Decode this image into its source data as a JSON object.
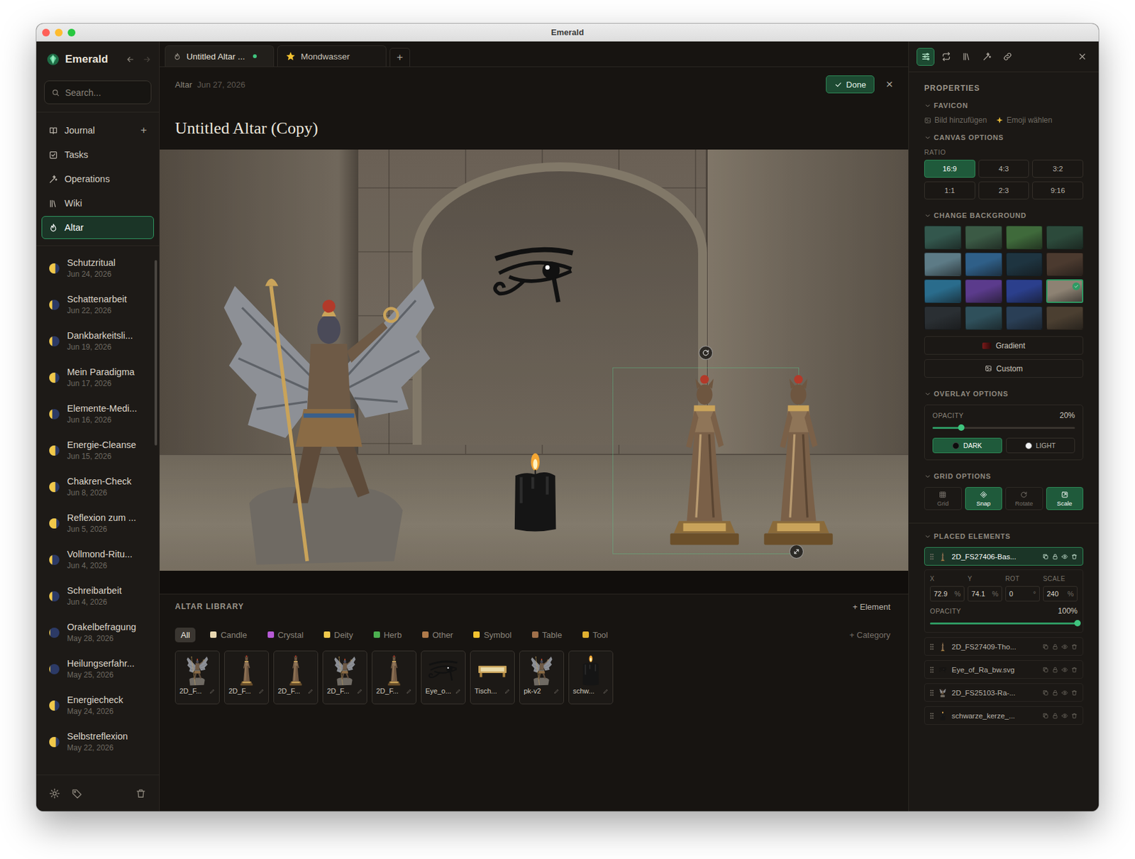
{
  "window": {
    "title": "Emerald"
  },
  "sidebar": {
    "brand": "Emerald",
    "search": {
      "placeholder": "Search..."
    },
    "nav": [
      {
        "label": "Journal",
        "kind": "journal",
        "add": "+",
        "selected": false
      },
      {
        "label": "Tasks",
        "kind": "tasks",
        "selected": false
      },
      {
        "label": "Operations",
        "kind": "operations",
        "selected": false
      },
      {
        "label": "Wiki",
        "kind": "wiki",
        "selected": false
      },
      {
        "label": "Altar",
        "kind": "altar",
        "selected": true
      }
    ],
    "entries": [
      {
        "title": "Schutzritual",
        "date": "Jun 24, 2026",
        "moon": 0.6
      },
      {
        "title": "Schattenarbeit",
        "date": "Jun 22, 2026",
        "moon": 0.3
      },
      {
        "title": "Dankbarkeitsli...",
        "date": "Jun 19, 2026",
        "moon": 0.3
      },
      {
        "title": "Mein Paradigma",
        "date": "Jun 17, 2026",
        "moon": 0.6
      },
      {
        "title": "Elemente-Medi...",
        "date": "Jun 16, 2026",
        "moon": 0.3
      },
      {
        "title": "Energie-Cleanse",
        "date": "Jun 15, 2026",
        "moon": 0.6
      },
      {
        "title": "Chakren-Check",
        "date": "Jun 8, 2026",
        "moon": 0.6
      },
      {
        "title": "Reflexion zum ...",
        "date": "Jun 5, 2026",
        "moon": 0.7
      },
      {
        "title": "Vollmond-Ritu...",
        "date": "Jun 4, 2026",
        "moon": 0.3
      },
      {
        "title": "Schreibarbeit",
        "date": "Jun 4, 2026",
        "moon": 0.3
      },
      {
        "title": "Orakelbefragung",
        "date": "May 28, 2026",
        "moon": 0.1
      },
      {
        "title": "Heilungserfahr...",
        "date": "May 25, 2026",
        "moon": 0.1
      },
      {
        "title": "Energiecheck",
        "date": "May 24, 2026",
        "moon": 0.55
      },
      {
        "title": "Selbstreflexion",
        "date": "May 22, 2026",
        "moon": 0.65
      }
    ]
  },
  "tabs": [
    {
      "label": "Untitled Altar ...",
      "kind": "altar",
      "unsaved": true,
      "selected": true
    },
    {
      "label": "Mondwasser",
      "kind": "star",
      "unsaved": false,
      "selected": false
    }
  ],
  "new_tab": "+",
  "header": {
    "breadcrumb": "Altar",
    "date": "Jun 27, 2026",
    "done": "Done",
    "close": "×"
  },
  "title": "Untitled Altar (Copy)",
  "library": {
    "title": "ALTAR LIBRARY",
    "add_element": "+ Element",
    "add_category": "+ Category",
    "categories": [
      {
        "label": "All",
        "selected": true
      },
      {
        "label": "Candle",
        "selected": false,
        "color": "#e8d7b0"
      },
      {
        "label": "Crystal",
        "selected": false,
        "color": "#b65ad6"
      },
      {
        "label": "Deity",
        "selected": false,
        "color": "#f2c94c"
      },
      {
        "label": "Herb",
        "selected": false,
        "color": "#4caf50"
      },
      {
        "label": "Other",
        "selected": false,
        "color": "#b07a4a"
      },
      {
        "label": "Symbol",
        "selected": false,
        "color": "#f2c230"
      },
      {
        "label": "Table",
        "selected": false,
        "color": "#a0704a"
      },
      {
        "label": "Tool",
        "selected": false,
        "color": "#e0b030"
      }
    ],
    "items": [
      {
        "label": "2D_F...",
        "kind": "winged"
      },
      {
        "label": "2D_F...",
        "kind": "statue"
      },
      {
        "label": "2D_F...",
        "kind": "statue"
      },
      {
        "label": "2D_F...",
        "kind": "winged"
      },
      {
        "label": "2D_F...",
        "kind": "statue"
      },
      {
        "label": "Eye_o...",
        "kind": "eye"
      },
      {
        "label": "Tisch...",
        "kind": "table"
      },
      {
        "label": "pk-v2",
        "kind": "winged"
      },
      {
        "label": "schw...",
        "kind": "candle"
      }
    ]
  },
  "properties": {
    "title": "PROPERTIES",
    "favicon": {
      "title": "FAVICON",
      "add_image": "Bild hinzufügen",
      "choose_emoji": "Emoji wählen"
    },
    "canvas": {
      "title": "CANVAS OPTIONS",
      "ratio_label": "RATIO",
      "ratios": [
        {
          "label": "16:9",
          "selected": true
        },
        {
          "label": "4:3",
          "selected": false
        },
        {
          "label": "3:2",
          "selected": false
        },
        {
          "label": "1:1",
          "selected": false
        },
        {
          "label": "2:3",
          "selected": false
        },
        {
          "label": "9:16",
          "selected": false
        }
      ]
    },
    "background": {
      "title": "CHANGE BACKGROUND",
      "swatches": [
        {
          "color": "#33574d",
          "selected": false
        },
        {
          "color": "#3b5a45",
          "selected": false
        },
        {
          "color": "#3f6a3b",
          "selected": false
        },
        {
          "color": "#2c4a3b",
          "selected": false
        },
        {
          "color": "#5d7b86",
          "selected": false
        },
        {
          "color": "#2f5f88",
          "selected": false
        },
        {
          "color": "#1e3440",
          "selected": false
        },
        {
          "color": "#4b3a2f",
          "selected": false
        },
        {
          "color": "#2a6c8c",
          "selected": false
        },
        {
          "color": "#5b3b8c",
          "selected": false
        },
        {
          "color": "#2b3f8c",
          "selected": false
        },
        {
          "color": "#8d8273",
          "selected": true
        },
        {
          "color": "#2a2f33",
          "selected": false
        },
        {
          "color": "#2f505b",
          "selected": false
        },
        {
          "color": "#2a3f56",
          "selected": false
        },
        {
          "color": "#4b3f31",
          "selected": false
        }
      ],
      "gradient": "Gradient",
      "custom": "Custom"
    },
    "overlay": {
      "title": "OVERLAY OPTIONS",
      "opacity_label": "OPACITY",
      "opacity": "20%",
      "level": 0.2,
      "modes": [
        {
          "label": "DARK",
          "kind": "dark",
          "selected": true
        },
        {
          "label": "LIGHT",
          "kind": "light",
          "selected": false
        }
      ]
    },
    "grid": {
      "title": "GRID OPTIONS",
      "options": [
        {
          "label": "Grid",
          "kind": "grid",
          "on": false
        },
        {
          "label": "Snap",
          "kind": "snap",
          "on": true
        },
        {
          "label": "Rotate",
          "kind": "rotate",
          "on": false
        },
        {
          "label": "Scale",
          "kind": "scale",
          "on": true
        }
      ]
    },
    "placed": {
      "title": "PLACED ELEMENTS",
      "elements": [
        {
          "name": "2D_FS27406-Bas...",
          "kind": "statue",
          "selected": true
        },
        {
          "name": "2D_FS27409-Tho...",
          "kind": "statue",
          "selected": false
        },
        {
          "name": "Eye_of_Ra_bw.svg",
          "kind": "eye",
          "selected": false
        },
        {
          "name": "2D_FS25103-Ra-...",
          "kind": "winged",
          "selected": false
        },
        {
          "name": "schwarze_kerze_...",
          "kind": "candle",
          "selected": false
        }
      ],
      "detail": {
        "fields": [
          {
            "label": "X",
            "value": "72.9",
            "unit": "%"
          },
          {
            "label": "Y",
            "value": "74.1",
            "unit": "%"
          },
          {
            "label": "ROT",
            "value": "0",
            "unit": "°"
          },
          {
            "label": "SCALE",
            "value": "240",
            "unit": "%"
          }
        ],
        "opacity_label": "OPACITY",
        "opacity": "100%",
        "level": 1
      }
    }
  }
}
